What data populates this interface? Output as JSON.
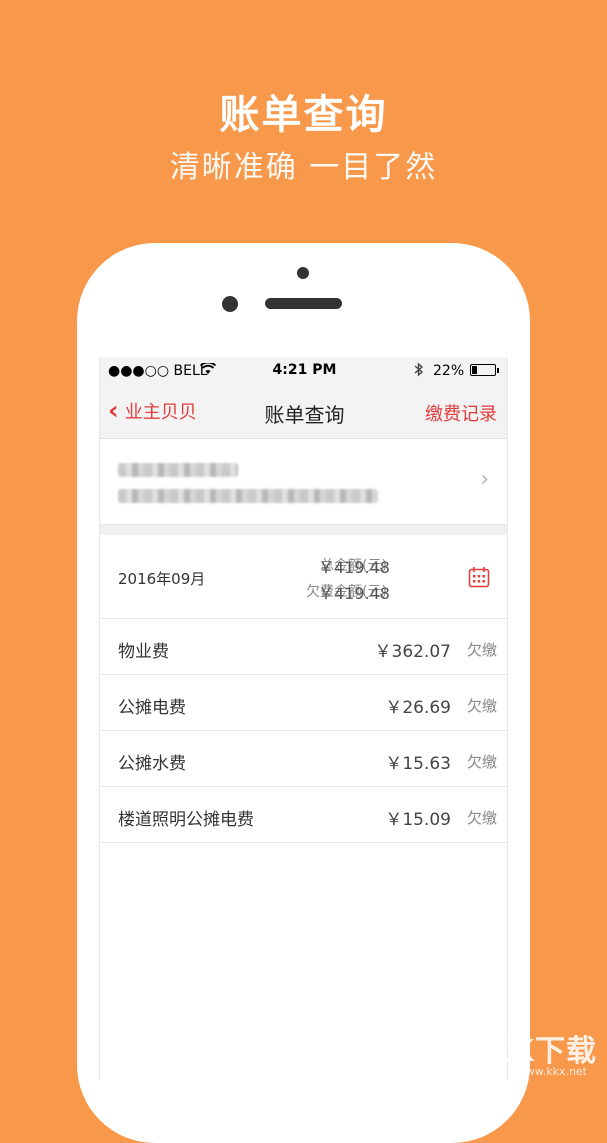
{
  "promo": {
    "title": "账单查询",
    "subtitle": "清晰准确 一目了然"
  },
  "status_bar": {
    "carrier": "●●●○○ BELL",
    "time": "4:21 PM",
    "battery_pct": "22%",
    "battery_level": 0.22
  },
  "nav": {
    "back_label": "业主贝贝",
    "title": "账单查询",
    "right_label": "缴费记录"
  },
  "summary": {
    "month": "2016年09月",
    "total_label": "总金额(元)",
    "total_value": "￥419.48",
    "owed_label": "欠费金额(元)",
    "owed_value": "￥419.48"
  },
  "fees": [
    {
      "name": "物业费",
      "amount": "￥362.07",
      "status": "欠缴"
    },
    {
      "name": "公摊电费",
      "amount": "￥26.69",
      "status": "欠缴"
    },
    {
      "name": "公摊水费",
      "amount": "￥15.63",
      "status": "欠缴"
    },
    {
      "name": "楼道照明公摊电费",
      "amount": "￥15.09",
      "status": "欠缴"
    }
  ],
  "watermark": {
    "logo": "KK下载",
    "url": "www.kkx.net"
  },
  "colors": {
    "background": "#F7984A",
    "accent": "#E23C3C"
  },
  "icons": {
    "back": "chevron-left-icon",
    "wifi": "wifi-icon",
    "bluetooth": "bluetooth-icon",
    "calendar": "calendar-icon",
    "disclosure": "chevron-right-icon"
  }
}
